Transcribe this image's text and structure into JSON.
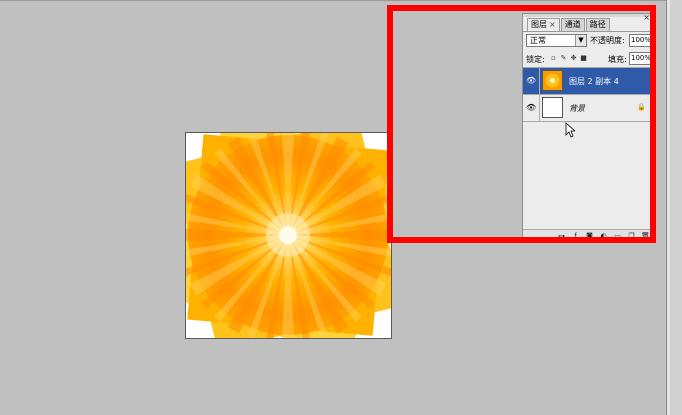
{
  "panel": {
    "tabs": [
      {
        "label": "图层",
        "close": "×",
        "active": true
      },
      {
        "label": "通道",
        "active": false
      },
      {
        "label": "路径",
        "active": false
      }
    ],
    "blend_mode": "正常",
    "opacity_label": "不透明度:",
    "opacity_value": "100%",
    "lock_label": "锁定:",
    "fill_label": "填充:",
    "fill_value": "100%",
    "layers": [
      {
        "name": "图层 2 副本 4",
        "selected": true,
        "visible": true
      },
      {
        "name": "背景",
        "selected": false,
        "visible": true,
        "locked": true
      }
    ],
    "footer_icons": [
      "link-icon",
      "fx-icon",
      "mask-icon",
      "adjustment-icon",
      "group-icon",
      "new-layer-icon",
      "trash-icon"
    ]
  },
  "colors": {
    "highlight": "#ff0000",
    "selection": "#2e5aa8",
    "canvas_bg": "#c0c0c0"
  }
}
